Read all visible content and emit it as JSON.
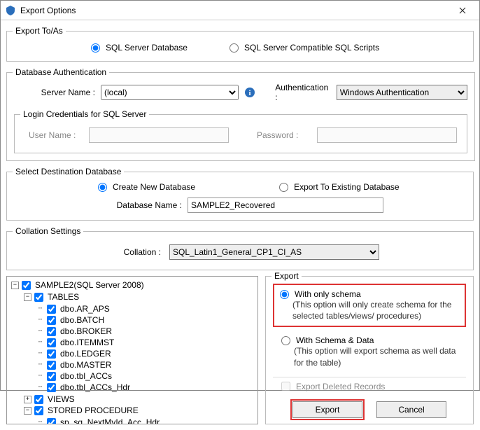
{
  "window": {
    "title": "Export Options"
  },
  "export_to": {
    "legend": "Export To/As",
    "opt_db": "SQL Server Database",
    "opt_scripts": "SQL Server Compatible SQL Scripts",
    "selected": "db"
  },
  "db_auth": {
    "legend": "Database Authentication",
    "server_label": "Server Name :",
    "server_value": "(local)",
    "auth_label": "Authentication :",
    "auth_value": "Windows Authentication",
    "cred_legend": "Login Credentials for SQL Server",
    "user_label": "User Name :",
    "user_value": "",
    "pass_label": "Password :",
    "pass_value": ""
  },
  "dest_db": {
    "legend": "Select Destination Database",
    "opt_new": "Create New Database",
    "opt_existing": "Export To Existing Database",
    "selected": "new",
    "name_label": "Database Name :",
    "name_value": "SAMPLE2_Recovered"
  },
  "collation": {
    "legend": "Collation Settings",
    "label": "Collation :",
    "value": "SQL_Latin1_General_CP1_CI_AS"
  },
  "tree": {
    "root": "SAMPLE2(SQL Server 2008)",
    "tables_label": "TABLES",
    "tables": [
      "dbo.AR_APS",
      "dbo.BATCH",
      "dbo.BROKER",
      "dbo.ITEMMST",
      "dbo.LEDGER",
      "dbo.MASTER",
      "dbo.tbl_ACCs",
      "dbo.tbl_ACCs_Hdr"
    ],
    "views_label": "VIEWS",
    "sp_label": "STORED PROCEDURE",
    "sp_items": [
      "sp_sg_NextMyId_Acc_Hdr"
    ]
  },
  "export_opts": {
    "legend": "Export",
    "schema_only": "With only schema",
    "schema_only_desc": "(This option will only create schema for the  selected tables/views/ procedures)",
    "schema_data": "With Schema & Data",
    "schema_data_desc": "(This option will export schema as well data for the table)",
    "selected": "schema_only",
    "deleted_label": "Export Deleted Records"
  },
  "buttons": {
    "export": "Export",
    "cancel": "Cancel"
  }
}
